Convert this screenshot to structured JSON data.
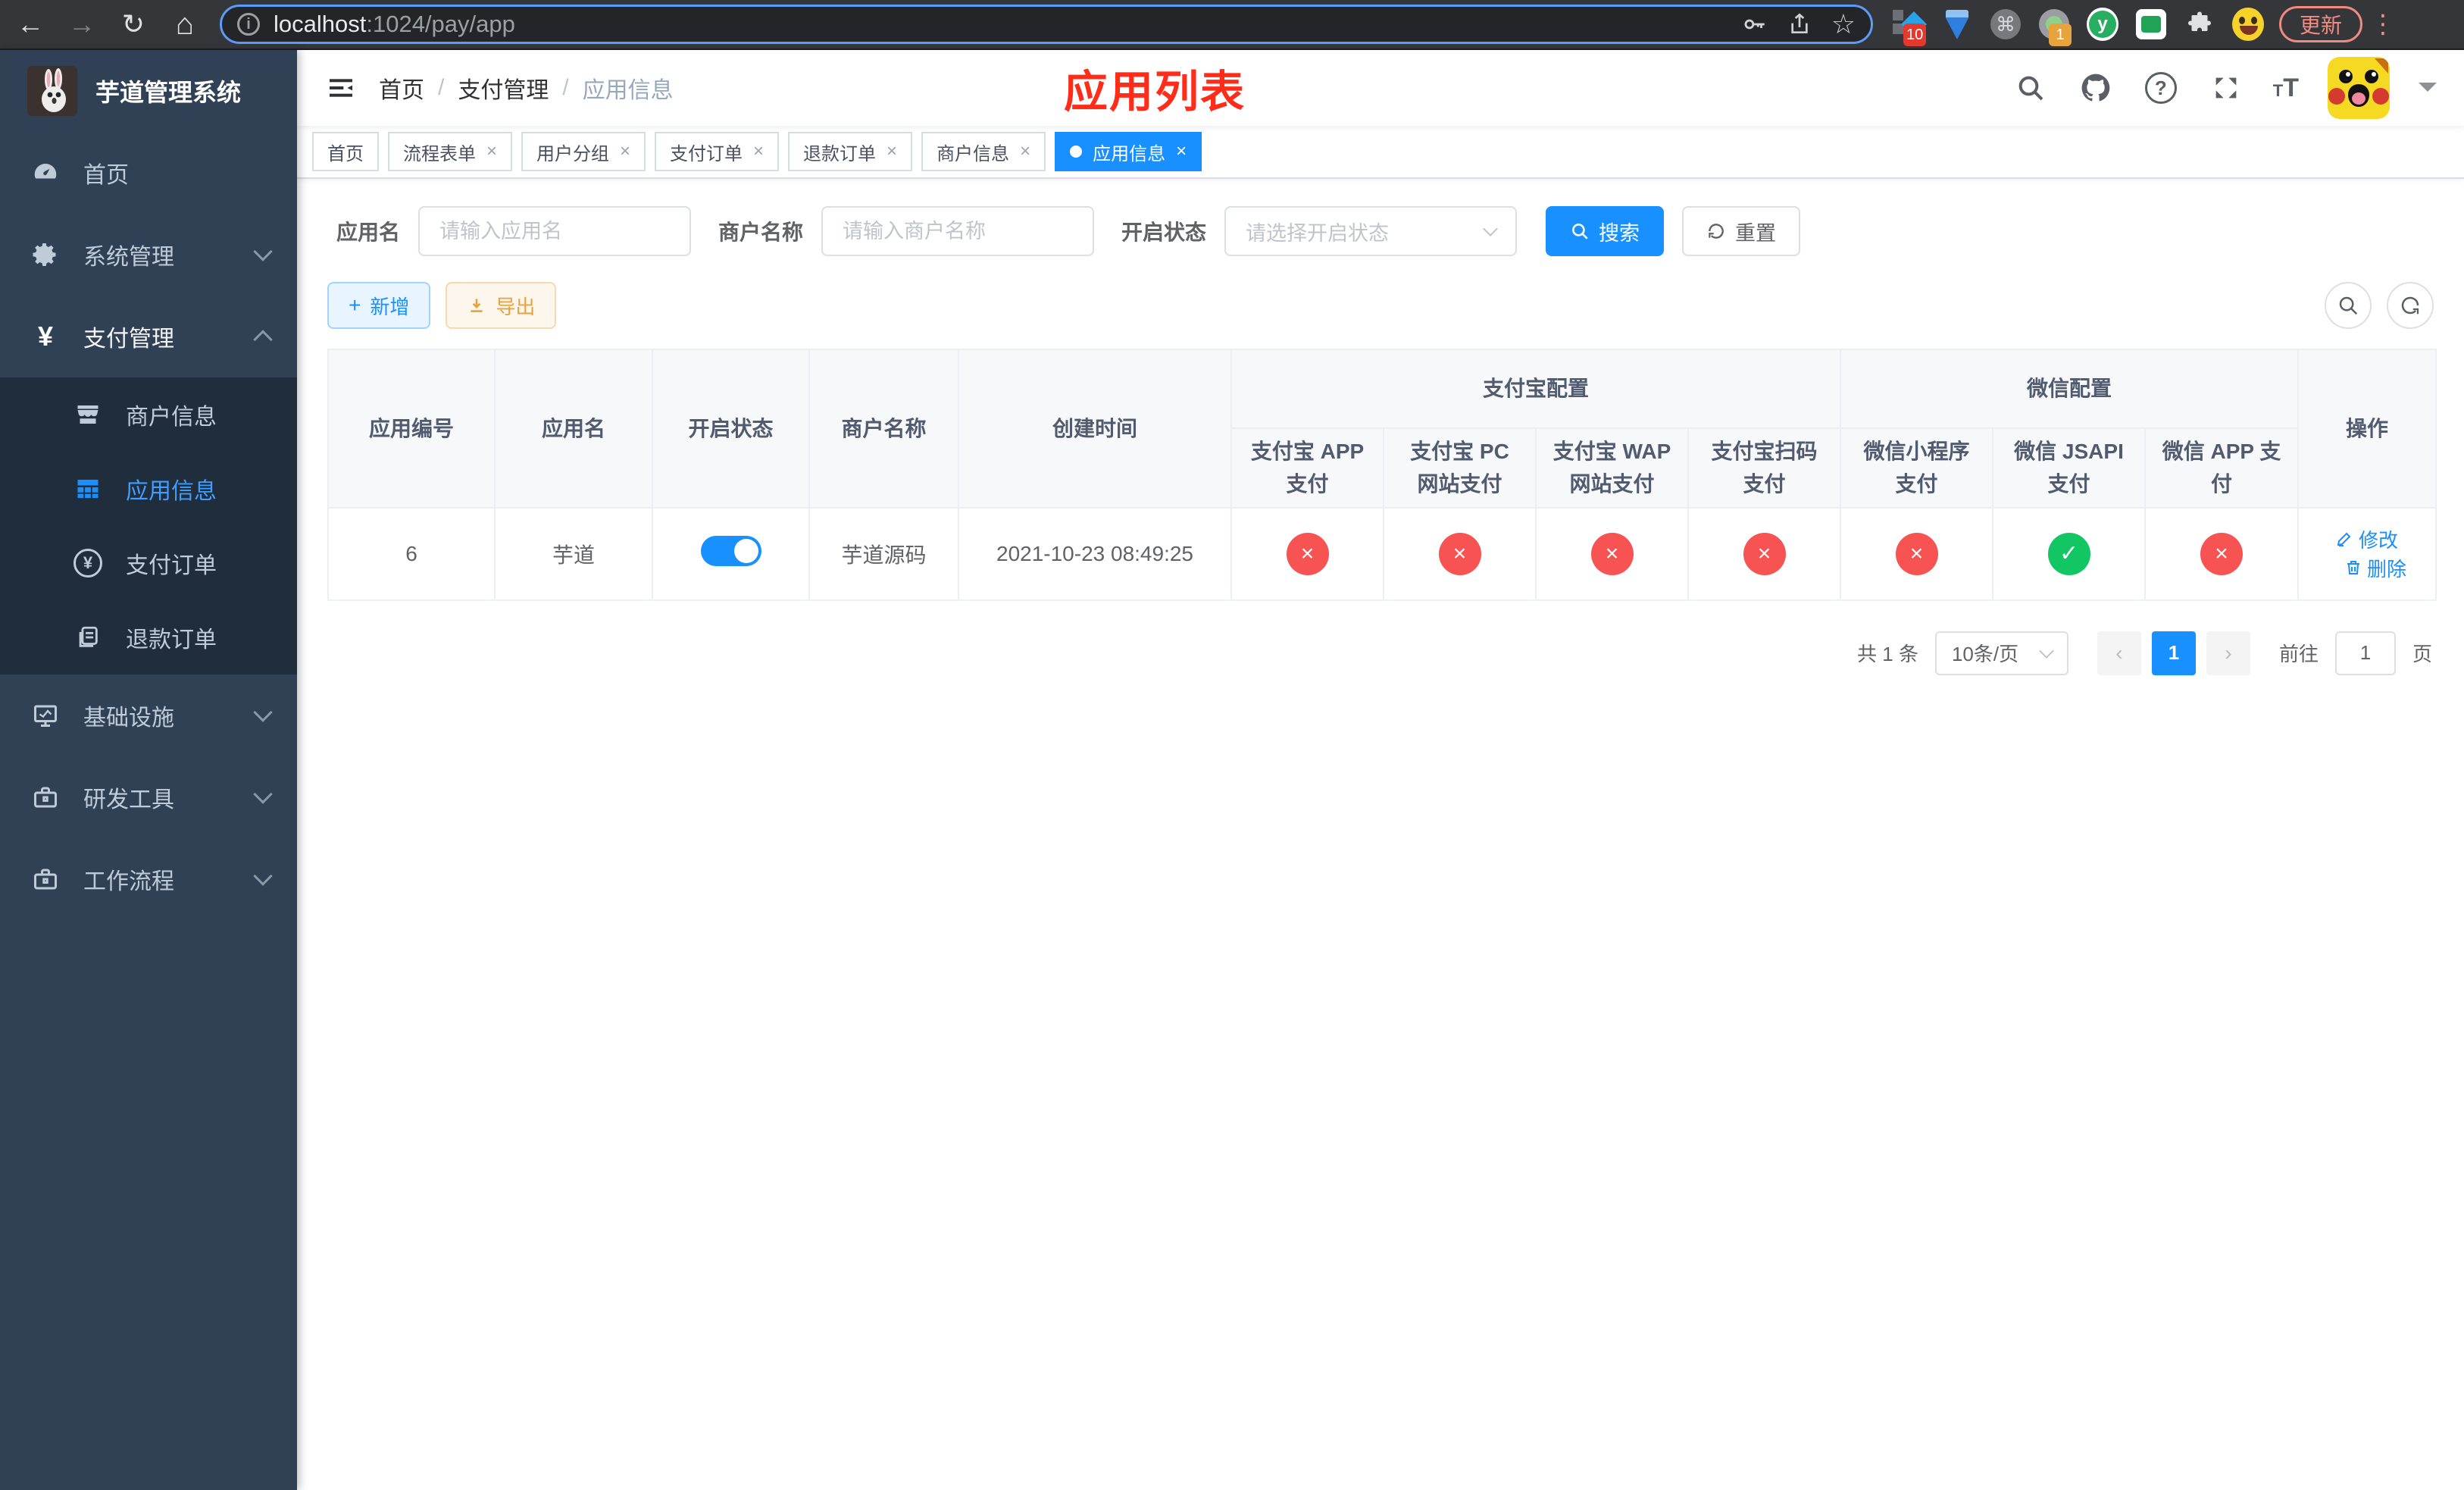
{
  "browser": {
    "url_host": "localhost",
    "url_rest": ":1024/pay/app",
    "update_label": "更新",
    "ext_badge_blue_diamond": "10",
    "ext_badge_camera": "1",
    "ext_y_letter": "y"
  },
  "annotation": {
    "text": "应用列表",
    "color": "#fe2c19"
  },
  "sidebar": {
    "title": "芋道管理系统",
    "items": [
      {
        "label": "首页",
        "icon": "gauge-icon"
      },
      {
        "label": "系统管理",
        "icon": "gear-icon"
      },
      {
        "label": "支付管理",
        "icon": "yen-icon"
      }
    ],
    "payment_children": [
      {
        "label": "商户信息",
        "icon": "storefront-icon"
      },
      {
        "label": "应用信息",
        "icon": "grid-icon",
        "active": true
      },
      {
        "label": "支付订单",
        "icon": "yen-circle-icon"
      },
      {
        "label": "退款订单",
        "icon": "copy-icon"
      }
    ],
    "bottom_items": [
      {
        "label": "基础设施",
        "icon": "monitor-icon"
      },
      {
        "label": "研发工具",
        "icon": "briefcase-icon"
      },
      {
        "label": "工作流程",
        "icon": "briefcase-icon"
      }
    ]
  },
  "header": {
    "breadcrumb": [
      "首页",
      "支付管理",
      "应用信息"
    ],
    "help_glyph": "?"
  },
  "tabs": [
    {
      "label": "首页",
      "closable": false
    },
    {
      "label": "流程表单",
      "closable": true
    },
    {
      "label": "用户分组",
      "closable": true
    },
    {
      "label": "支付订单",
      "closable": true
    },
    {
      "label": "退款订单",
      "closable": true
    },
    {
      "label": "商户信息",
      "closable": true
    },
    {
      "label": "应用信息",
      "closable": true,
      "active": true
    }
  ],
  "search": {
    "app_name_label": "应用名",
    "app_name_placeholder": "请输入应用名",
    "merchant_label": "商户名称",
    "merchant_placeholder": "请输入商户名称",
    "status_label": "开启状态",
    "status_placeholder": "请选择开启状态",
    "search_label": "搜索",
    "reset_label": "重置"
  },
  "toolbar": {
    "add_label": "新增",
    "export_label": "导出"
  },
  "table": {
    "columns": {
      "app_id": "应用编号",
      "app_name": "应用名",
      "status": "开启状态",
      "merchant": "商户名称",
      "created": "创建时间",
      "actions": "操作"
    },
    "groups": {
      "alipay": "支付宝配置",
      "wechat": "微信配置"
    },
    "sub_columns": {
      "alipay_app": "支付宝 APP 支付",
      "alipay_pc": "支付宝 PC 网站支付",
      "alipay_wap": "支付宝 WAP 网站支付",
      "alipay_qr": "支付宝扫码支付",
      "wx_mini": "微信小程序支付",
      "wx_jsapi": "微信 JSAPI 支付",
      "wx_app": "微信 APP 支付"
    },
    "rows": [
      {
        "app_id": "6",
        "app_name": "芋道",
        "enabled": true,
        "merchant_name": "芋道源码",
        "create_time": "2021-10-23 08:49:25",
        "alipay_app": "disabled",
        "alipay_pc": "disabled",
        "alipay_wap": "disabled",
        "alipay_qr": "disabled",
        "wx_mini": "disabled",
        "wx_jsapi": "enabled",
        "wx_app": "disabled",
        "edit_label": "修改",
        "delete_label": "删除"
      }
    ]
  },
  "pagination": {
    "total": "共 1 条",
    "page_size": "10条/页",
    "page": "1",
    "goto_label": "前往",
    "goto_value": "1",
    "unit": "页"
  },
  "colors": {
    "accent": "#1890ff",
    "sidebar_bg": "#304156",
    "submenu_bg": "#1f2d3d",
    "success": "#12c763",
    "danger": "#f75353",
    "warning": "#e6a23c"
  }
}
